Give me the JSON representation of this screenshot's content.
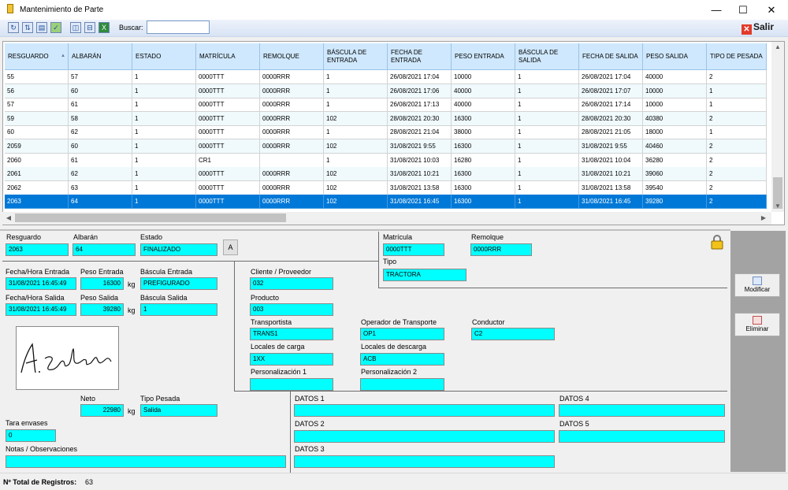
{
  "window": {
    "title": "Mantenimiento de Parte",
    "minimize": "—",
    "maximize": "☐",
    "close": "✕"
  },
  "toolbar": {
    "buscar_label": "Buscar:",
    "buscar_value": "",
    "salir_label": "Salir"
  },
  "grid": {
    "columns": [
      "RESGUARDO",
      "ALBARÁN",
      "ESTADO",
      "MATRÍCULA",
      "REMOLQUE",
      "BÁSCULA DE ENTRADA",
      "FECHA DE ENTRADA",
      "PESO ENTRADA",
      "BÁSCULA DE SALIDA",
      "FECHA DE SALIDA",
      "PESO SALIDA",
      "TIPO DE PESADA"
    ],
    "sort_indicator": "▲",
    "rows": [
      [
        "55",
        "57",
        "1",
        "0000TTT",
        "0000RRR",
        "1",
        "26/08/2021 17:04",
        "10000",
        "1",
        "26/08/2021 17:04",
        "40000",
        "2"
      ],
      [
        "56",
        "60",
        "1",
        "0000TTT",
        "0000RRR",
        "1",
        "26/08/2021 17:06",
        "40000",
        "1",
        "26/08/2021 17:07",
        "10000",
        "1"
      ],
      [
        "57",
        "61",
        "1",
        "0000TTT",
        "0000RRR",
        "1",
        "26/08/2021 17:13",
        "40000",
        "1",
        "26/08/2021 17:14",
        "10000",
        "1"
      ],
      [
        "59",
        "58",
        "1",
        "0000TTT",
        "0000RRR",
        "102",
        "28/08/2021 20:30",
        "16300",
        "1",
        "28/08/2021 20:30",
        "40380",
        "2"
      ],
      [
        "60",
        "62",
        "1",
        "0000TTT",
        "0000RRR",
        "1",
        "28/08/2021 21:04",
        "38000",
        "1",
        "28/08/2021 21:05",
        "18000",
        "1"
      ],
      [
        "2059",
        "60",
        "1",
        "0000TTT",
        "0000RRR",
        "102",
        "31/08/2021 9:55",
        "16300",
        "1",
        "31/08/2021 9:55",
        "40460",
        "2"
      ],
      [
        "2060",
        "61",
        "1",
        "CR1",
        "",
        "1",
        "31/08/2021 10:03",
        "16280",
        "1",
        "31/08/2021 10:04",
        "36280",
        "2"
      ],
      [
        "2061",
        "62",
        "1",
        "0000TTT",
        "0000RRR",
        "102",
        "31/08/2021 10:21",
        "16300",
        "1",
        "31/08/2021 10:21",
        "39060",
        "2"
      ],
      [
        "2062",
        "63",
        "1",
        "0000TTT",
        "0000RRR",
        "102",
        "31/08/2021 13:58",
        "16300",
        "1",
        "31/08/2021 13:58",
        "39540",
        "2"
      ],
      [
        "2063",
        "64",
        "1",
        "0000TTT",
        "0000RRR",
        "102",
        "31/08/2021 16:45",
        "16300",
        "1",
        "31/08/2021 16:45",
        "39280",
        "2"
      ]
    ],
    "selected_row": 9
  },
  "detail": {
    "resguardo_label": "Resguardo",
    "resguardo": "2063",
    "albaran_label": "Albarán",
    "albaran": "64",
    "estado_label": "Estado",
    "estado": "FINALIZADO",
    "a_button": "A",
    "matricula_label": "Matrícula",
    "matricula": "0000TTT",
    "remolque_label": "Remolque",
    "remolque": "0000RRR",
    "tipo_label": "Tipo",
    "tipo": "TRACTORA",
    "fecha_entrada_label": "Fecha/Hora Entrada",
    "fecha_entrada": "31/08/2021 16:45:49",
    "peso_entrada_label": "Peso Entrada",
    "peso_entrada": "16300",
    "bascula_entrada_label": "Báscula Entrada",
    "bascula_entrada": "PREFIGURADO",
    "fecha_salida_label": "Fecha/Hora Salida",
    "fecha_salida": "31/08/2021 16:45:49",
    "peso_salida_label": "Peso Salida",
    "peso_salida": "39280",
    "bascula_salida_label": "Báscula Salida",
    "bascula_salida": "1",
    "kg": "kg",
    "cliente_label": "Cliente / Proveedor",
    "cliente": "032",
    "producto_label": "Producto",
    "producto": "003",
    "transportista_label": "Transportista",
    "transportista": "TRANS1",
    "operador_label": "Operador de Transporte",
    "operador": "OP1",
    "conductor_label": "Conductor",
    "conductor": "C2",
    "locales_carga_label": "Locales de carga",
    "locales_carga": "1XX",
    "locales_descarga_label": "Locales de descarga",
    "locales_descarga": "ACB",
    "pers1_label": "Personalización 1",
    "pers1": "",
    "pers2_label": "Personalización 2",
    "pers2": "",
    "neto_label": "Neto",
    "neto": "22980",
    "tipo_pesada_label": "Tipo Pesada",
    "tipo_pesada": "Salida",
    "tara_label": "Tara envases",
    "tara": "0",
    "notas_label": "Notas / Observaciones",
    "notas": "",
    "datos1_label": "DATOS 1",
    "datos1": "",
    "datos2_label": "DATOS 2",
    "datos2": "",
    "datos3_label": "DATOS 3",
    "datos3": "",
    "datos4_label": "DATOS 4",
    "datos4": "",
    "datos5_label": "DATOS 5",
    "datos5": ""
  },
  "side": {
    "modificar": "Modificar",
    "eliminar": "Eliminar"
  },
  "status": {
    "total_label": "Nº Total de Registros:",
    "total": "63"
  },
  "colors": {
    "field": "#00ffff",
    "selection": "#0078d7",
    "header": "#cfe8fd"
  }
}
